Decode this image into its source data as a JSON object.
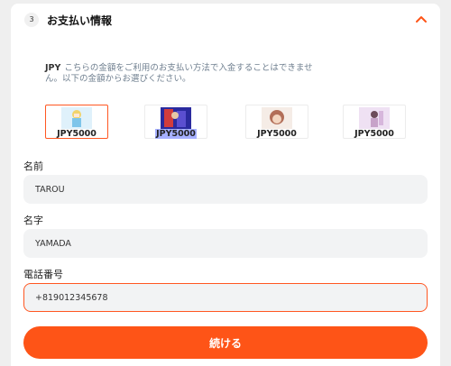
{
  "header": {
    "step": "3",
    "title": "お支払い情報",
    "collapse_icon": "chevron-up-icon"
  },
  "notice": {
    "currency": "JPY",
    "text": "こちらの金額をご利用のお支払い方法で入金することはできません。以下の金額からお選びください。"
  },
  "amounts": [
    {
      "label": "JPY5000",
      "selected": true
    },
    {
      "label": "JPY5000",
      "selected": false,
      "highlighted": true
    },
    {
      "label": "JPY5000",
      "selected": false
    },
    {
      "label": "JPY5000",
      "selected": false
    }
  ],
  "form": {
    "first_name": {
      "label": "名前",
      "value": "TAROU"
    },
    "last_name": {
      "label": "名字",
      "value": "YAMADA"
    },
    "phone": {
      "label": "電話番号",
      "value": "+819012345678"
    }
  },
  "submit_label": "続ける",
  "colors": {
    "accent": "#fe5417",
    "input_bg": "#f2f3f4",
    "notice_text": "#6f7f8f"
  }
}
